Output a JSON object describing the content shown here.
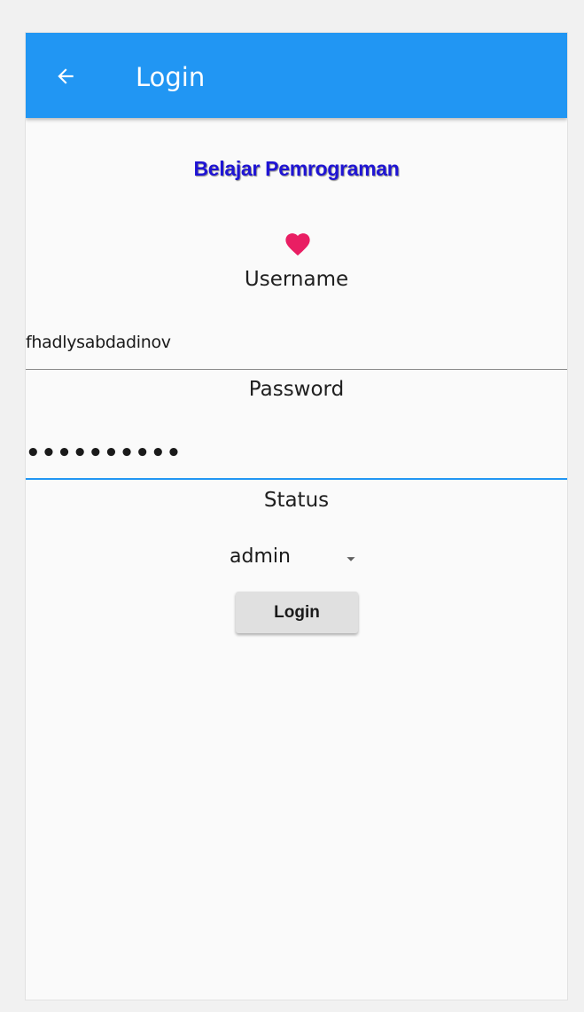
{
  "app_bar": {
    "title": "Login",
    "back_icon": "arrow-left-icon",
    "color": "#2196f3"
  },
  "heading": {
    "text": "Belajar Pemrograman",
    "color": "#1f14d4"
  },
  "heart_icon": {
    "name": "heart-icon",
    "color": "#e91e63"
  },
  "form": {
    "username": {
      "label": "Username",
      "value": "fhadlysabdadinov"
    },
    "password": {
      "label": "Password",
      "masked_value": "••••••••••"
    },
    "status": {
      "label": "Status",
      "selected": "admin",
      "caret_icon": "caret-down-icon"
    },
    "submit_label": "Login"
  }
}
